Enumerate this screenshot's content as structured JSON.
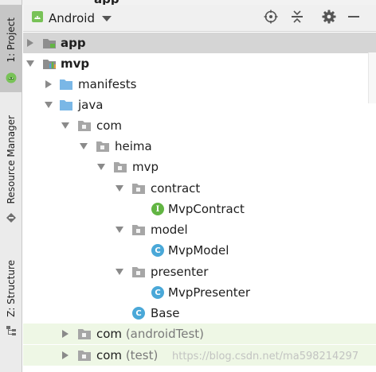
{
  "top": {
    "cut_title": "app"
  },
  "side_tabs": {
    "project": "1: Project",
    "resource_manager": "Resource Manager",
    "structure": "Z: Structure"
  },
  "toolbar": {
    "view_label": "Android",
    "view_icon": "android-icon",
    "buttons": [
      "locate-icon",
      "collapse-all-icon",
      "gear-icon",
      "hide-icon"
    ]
  },
  "tree": [
    {
      "label": "app",
      "bold": true,
      "icon": "module-folder",
      "expanded": false,
      "selected": true
    },
    {
      "label": "mvp",
      "bold": true,
      "icon": "module-folder",
      "expanded": true
    },
    {
      "label": "manifests",
      "icon": "folder",
      "expanded": false
    },
    {
      "label": "java",
      "icon": "folder",
      "expanded": true
    },
    {
      "label": "com",
      "icon": "package",
      "expanded": true
    },
    {
      "label": "heima",
      "icon": "package",
      "expanded": true
    },
    {
      "label": "mvp",
      "icon": "package",
      "expanded": true
    },
    {
      "label": "contract",
      "icon": "package",
      "expanded": true
    },
    {
      "label": "MvpContract",
      "icon": "interface",
      "badge": "I"
    },
    {
      "label": "model",
      "icon": "package",
      "expanded": true
    },
    {
      "label": "MvpModel",
      "icon": "class",
      "badge": "C"
    },
    {
      "label": "presenter",
      "icon": "package",
      "expanded": true
    },
    {
      "label": "MvpPresenter",
      "icon": "class",
      "badge": "C"
    },
    {
      "label": "Base",
      "icon": "class",
      "badge": "C"
    },
    {
      "label": "com",
      "suffix": "(androidTest)",
      "icon": "package",
      "expanded": false
    },
    {
      "label": "com",
      "suffix": "(test)",
      "icon": "package",
      "expanded": false
    }
  ],
  "watermark": "https://blog.csdn.net/ma598214297",
  "colors": {
    "folder": "#7ab7e6",
    "package": "#9a9a9a",
    "class_badge": "#4aa8d8",
    "interface_badge": "#62b543",
    "test_row_bg": "#eef7e5",
    "selected_row_bg": "#d5d5d5",
    "android_green": "#78c257"
  }
}
